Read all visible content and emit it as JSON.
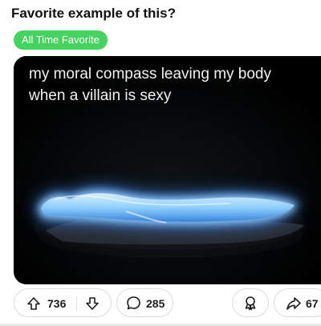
{
  "post": {
    "title": "Favorite example of this?",
    "flair": "All Time Favorite",
    "flair_color": "#46d160",
    "meme_caption": "my moral compass leaving my body when a villain is sexy"
  },
  "actions": {
    "score": "736",
    "comments": "285",
    "shares": "67",
    "icons": {
      "upvote": "upvote-arrow-icon",
      "downvote": "downvote-arrow-icon",
      "comment": "comment-bubble-icon",
      "award": "award-ribbon-icon",
      "share": "share-arrow-icon"
    }
  }
}
